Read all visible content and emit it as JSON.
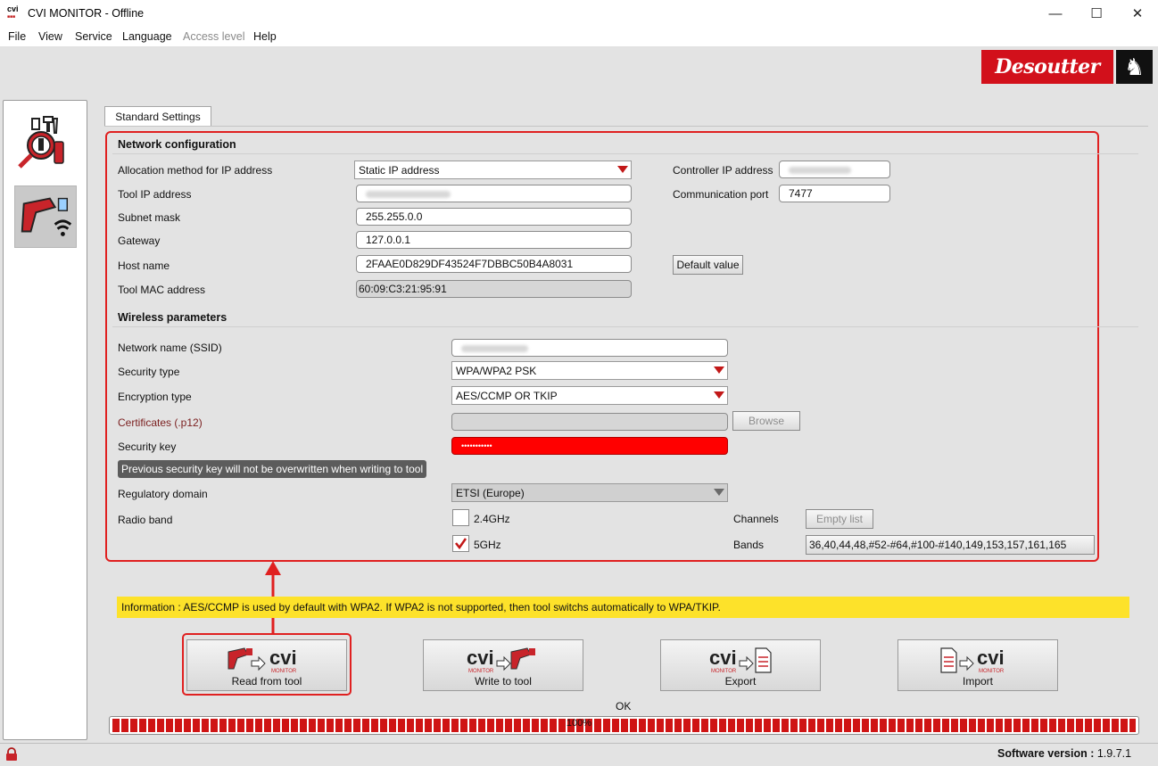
{
  "window": {
    "app_icon_text": "cvi",
    "title": "CVI MONITOR - Offline",
    "minimize": "—",
    "maximize": "☐",
    "close": "✕"
  },
  "menu": [
    "File",
    "View",
    "Service",
    "Language",
    "Access level",
    "Help"
  ],
  "brand": {
    "name": "Desoutter"
  },
  "tabs": [
    "Standard Settings"
  ],
  "network": {
    "title": "Network configuration",
    "allocation_label": "Allocation method for IP address",
    "allocation_value": "Static IP address",
    "tool_ip_label": "Tool IP address",
    "subnet_label": "Subnet mask",
    "subnet_value": "255.255.0.0",
    "gateway_label": "Gateway",
    "gateway_value": "127.0.0.1",
    "host_label": "Host name",
    "host_value": "2FAAE0D829DF43524F7DBBC50B4A8031",
    "default_value_button": "Default value",
    "mac_label": "Tool MAC address",
    "mac_value": "60:09:C3:21:95:91",
    "controller_ip_label": "Controller IP address",
    "port_label": "Communication port",
    "port_value": "7477"
  },
  "wireless": {
    "title": "Wireless parameters",
    "ssid_label": "Network name (SSID)",
    "security_type_label": "Security  type",
    "security_type_value": "WPA/WPA2 PSK",
    "encryption_label": "Encryption type",
    "encryption_value": "AES/CCMP OR TKIP",
    "cert_label": "Certificates (.p12)",
    "browse_button": "Browse",
    "security_key_label": "Security key",
    "security_key_value": "•••••••••••",
    "key_note": "Previous security key will not be overwritten when writing to tool",
    "regulatory_label": "Regulatory domain",
    "regulatory_value": "ETSI (Europe)",
    "radio_band_label": "Radio band",
    "band_24": "2.4GHz",
    "band_24_checked": false,
    "band_5": "5GHz",
    "band_5_checked": true,
    "channels_label": "Channels",
    "empty_list_button": "Empty list",
    "bands_label": "Bands",
    "bands_value": "36,40,44,48,#52-#64,#100-#140,149,153,157,161,165"
  },
  "info": "Information :  AES/CCMP is used by default with WPA2. If WPA2 is not supported, then tool switchs automatically  to WPA/TKIP.",
  "actions": {
    "read": "Read from tool",
    "write": "Write to tool",
    "export": "Export",
    "import": "Import",
    "logo_text": "cvi",
    "logo_sub": "MONITOR"
  },
  "status": {
    "message": "OK",
    "progress_text": "100%",
    "progress_fraction": 1.0
  },
  "footer": {
    "version_label": "Software version :",
    "version_value": " 1.9.7.1"
  },
  "colors": {
    "accent_red": "#d2101b",
    "highlight_red": "#e02020",
    "info_yellow": "#fde22a"
  }
}
